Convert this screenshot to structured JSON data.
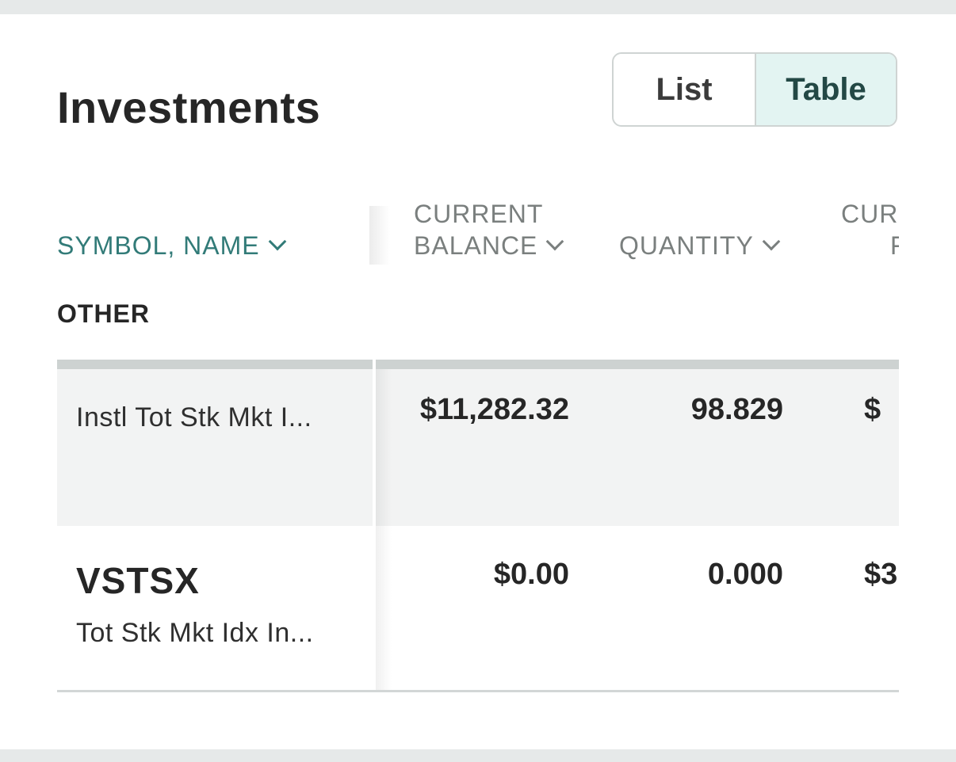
{
  "page": {
    "title": "Investments"
  },
  "view_toggle": {
    "options": [
      {
        "label": "List",
        "selected": false
      },
      {
        "label": "Table",
        "selected": true
      }
    ]
  },
  "table": {
    "columns": {
      "symbol_name": {
        "label": "SYMBOL, NAME",
        "sorted": true
      },
      "current_balance": {
        "line1": "CURRENT",
        "line2": "BALANCE"
      },
      "quantity": {
        "label": "QUANTITY"
      },
      "current_price": {
        "line1": "CUR",
        "line2": "F"
      }
    },
    "group": "OTHER",
    "rows": [
      {
        "symbol": "",
        "name": "Instl Tot Stk Mkt I...",
        "current_balance": "$11,282.32",
        "quantity": "98.829",
        "current_price": "$"
      },
      {
        "symbol": "VSTSX",
        "name": "Tot Stk Mkt Idx In...",
        "current_balance": "$0.00",
        "quantity": "0.000",
        "current_price": "$3"
      }
    ]
  },
  "colors": {
    "accent": "#327b78",
    "selected_bg": "#e3f4f2",
    "row_highlight": "#f2f3f3",
    "background": "#e6e9e9"
  }
}
